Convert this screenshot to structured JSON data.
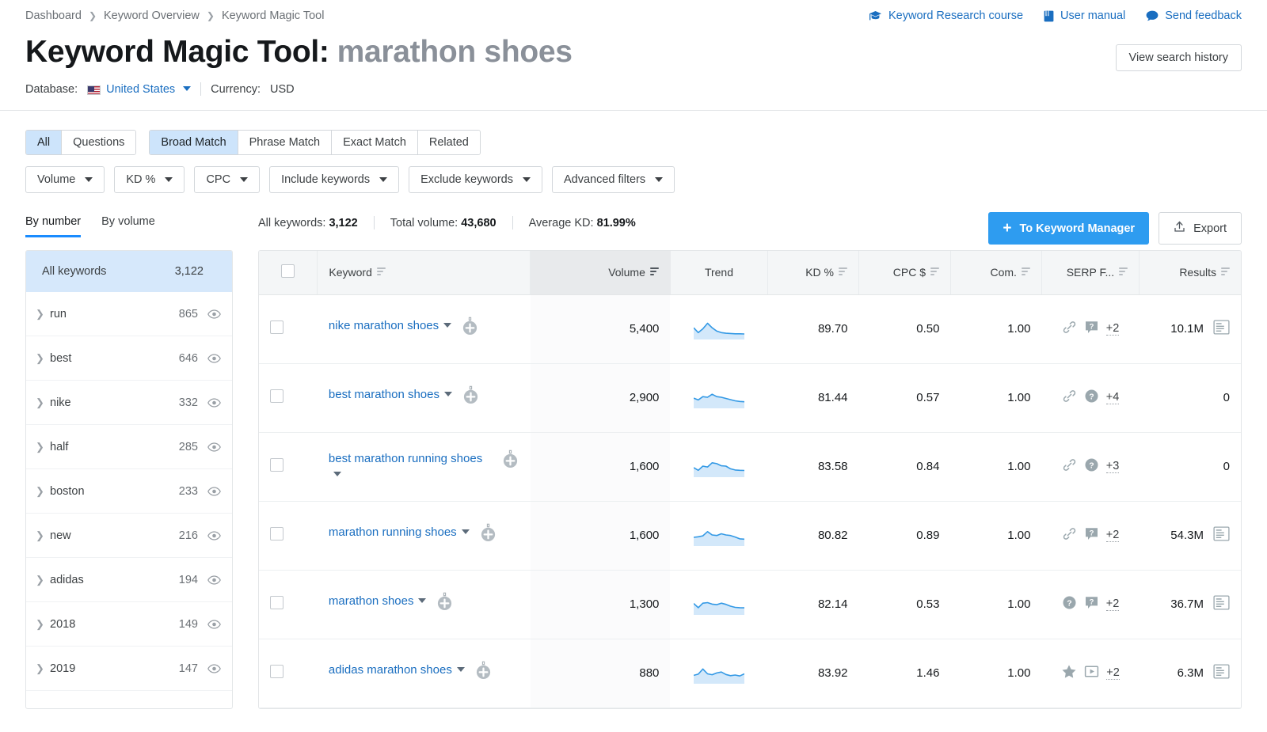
{
  "breadcrumb": [
    "Dashboard",
    "Keyword Overview",
    "Keyword Magic Tool"
  ],
  "head_links": [
    {
      "label": "Keyword Research course",
      "icon": "graduation-cap-icon"
    },
    {
      "label": "User manual",
      "icon": "book-icon"
    },
    {
      "label": "Send feedback",
      "icon": "speech-bubble-icon"
    }
  ],
  "title": {
    "prefix": "Keyword Magic Tool:",
    "query": "marathon shoes"
  },
  "view_history_label": "View search history",
  "database": {
    "label": "Database:",
    "country": "United States",
    "currency_label": "Currency:",
    "currency": "USD"
  },
  "filters": {
    "group_a": [
      {
        "label": "All",
        "active": true
      },
      {
        "label": "Questions",
        "active": false
      }
    ],
    "group_b": [
      {
        "label": "Broad Match",
        "active": true
      },
      {
        "label": "Phrase Match",
        "active": false
      },
      {
        "label": "Exact Match",
        "active": false
      },
      {
        "label": "Related",
        "active": false
      }
    ],
    "dropdowns": [
      "Volume",
      "KD %",
      "CPC",
      "Include keywords",
      "Exclude keywords",
      "Advanced filters"
    ]
  },
  "toolbar": {
    "view_tabs": [
      {
        "label": "By number",
        "active": true
      },
      {
        "label": "By volume",
        "active": false
      }
    ],
    "stats": [
      {
        "label": "All keywords:",
        "value": "3,122"
      },
      {
        "label": "Total volume:",
        "value": "43,680"
      },
      {
        "label": "Average KD:",
        "value": "81.99%"
      }
    ],
    "to_keyword_manager": "To Keyword Manager",
    "export": "Export"
  },
  "sidebar": {
    "all": {
      "label": "All keywords",
      "count": "3,122"
    },
    "items": [
      {
        "label": "run",
        "count": "865"
      },
      {
        "label": "best",
        "count": "646"
      },
      {
        "label": "nike",
        "count": "332"
      },
      {
        "label": "half",
        "count": "285"
      },
      {
        "label": "boston",
        "count": "233"
      },
      {
        "label": "new",
        "count": "216"
      },
      {
        "label": "adidas",
        "count": "194"
      },
      {
        "label": "2018",
        "count": "149"
      },
      {
        "label": "2019",
        "count": "147"
      }
    ]
  },
  "table": {
    "columns": [
      {
        "key": "checkbox",
        "label": ""
      },
      {
        "key": "keyword",
        "label": "Keyword",
        "sortable": true
      },
      {
        "key": "volume",
        "label": "Volume",
        "sortable": true,
        "sorted": true
      },
      {
        "key": "trend",
        "label": "Trend",
        "sortable": false
      },
      {
        "key": "kd",
        "label": "KD %",
        "sortable": true
      },
      {
        "key": "cpc",
        "label": "CPC $",
        "sortable": true
      },
      {
        "key": "com",
        "label": "Com.",
        "sortable": true
      },
      {
        "key": "serp",
        "label": "SERP F...",
        "sortable": true
      },
      {
        "key": "results",
        "label": "Results",
        "sortable": true
      }
    ],
    "rows": [
      {
        "keyword": "nike marathon shoes",
        "volume": "5,400",
        "kd": "89.70",
        "cpc": "0.50",
        "com": "1.00",
        "serp_icons": [
          "link-icon",
          "question-callout-icon"
        ],
        "serp_more": "+2",
        "results": "10.1M",
        "has_results_icon": true,
        "trend": [
          0.62,
          0.3,
          0.55,
          0.92,
          0.62,
          0.4,
          0.3,
          0.26,
          0.24,
          0.22,
          0.22,
          0.21
        ]
      },
      {
        "keyword": "best marathon shoes",
        "volume": "2,900",
        "kd": "81.44",
        "cpc": "0.57",
        "com": "1.00",
        "serp_icons": [
          "link-icon",
          "question-circle-icon"
        ],
        "serp_more": "+4",
        "results": "0",
        "has_results_icon": false,
        "trend": [
          0.52,
          0.4,
          0.62,
          0.58,
          0.78,
          0.62,
          0.58,
          0.5,
          0.42,
          0.34,
          0.3,
          0.28
        ]
      },
      {
        "keyword": "best marathon running shoes",
        "volume": "1,600",
        "kd": "83.58",
        "cpc": "0.84",
        "com": "1.00",
        "serp_icons": [
          "link-icon",
          "question-circle-icon"
        ],
        "serp_more": "+3",
        "results": "0",
        "has_results_icon": false,
        "trend": [
          0.48,
          0.3,
          0.58,
          0.52,
          0.8,
          0.74,
          0.6,
          0.58,
          0.4,
          0.32,
          0.3,
          0.29
        ]
      },
      {
        "keyword": "marathon running shoes",
        "volume": "1,600",
        "kd": "80.82",
        "cpc": "0.89",
        "com": "1.00",
        "serp_icons": [
          "link-icon",
          "question-callout-icon"
        ],
        "serp_more": "+2",
        "results": "54.3M",
        "has_results_icon": true,
        "trend": [
          0.42,
          0.46,
          0.52,
          0.8,
          0.58,
          0.54,
          0.66,
          0.58,
          0.54,
          0.44,
          0.32,
          0.3
        ]
      },
      {
        "keyword": "marathon shoes",
        "volume": "1,300",
        "kd": "82.14",
        "cpc": "0.53",
        "com": "1.00",
        "serp_icons": [
          "question-circle-icon",
          "question-callout-icon"
        ],
        "serp_more": "+2",
        "results": "36.7M",
        "has_results_icon": true,
        "trend": [
          0.6,
          0.32,
          0.62,
          0.66,
          0.56,
          0.52,
          0.62,
          0.54,
          0.42,
          0.34,
          0.32,
          0.31
        ]
      },
      {
        "keyword": "adidas marathon shoes",
        "volume": "880",
        "kd": "83.92",
        "cpc": "1.46",
        "com": "1.00",
        "serp_icons": [
          "star-icon",
          "video-icon"
        ],
        "serp_more": "+2",
        "results": "6.3M",
        "has_results_icon": true,
        "trend": [
          0.4,
          0.48,
          0.82,
          0.5,
          0.44,
          0.56,
          0.62,
          0.46,
          0.38,
          0.42,
          0.36,
          0.5
        ]
      }
    ]
  },
  "colors": {
    "link": "#1a6ec0",
    "accent": "#2e9cf0",
    "active_tab_bg": "#cde4fb",
    "sidebar_active_bg": "#d6e8fb",
    "spark_line": "#3399e5",
    "spark_fill": "#d3e8fa"
  }
}
